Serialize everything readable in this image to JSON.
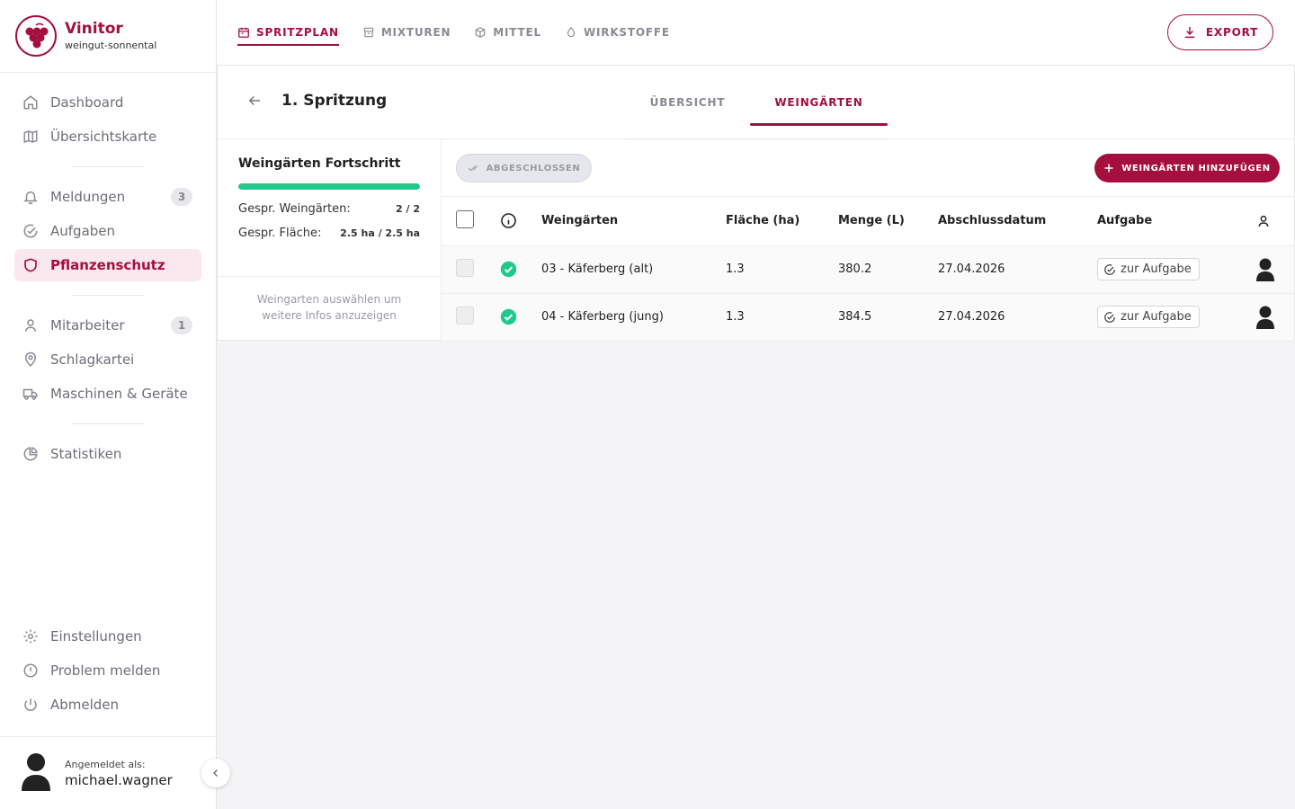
{
  "brand": {
    "name": "Vinitor",
    "subtitle": "weingut-sonnental",
    "accent": "#a50f3d"
  },
  "sidebar": {
    "group1": [
      {
        "label": "Dashboard",
        "icon": "home-icon"
      },
      {
        "label": "Übersichtskarte",
        "icon": "map-icon"
      }
    ],
    "group2": [
      {
        "label": "Meldungen",
        "icon": "bell-icon",
        "badge": "3"
      },
      {
        "label": "Aufgaben",
        "icon": "check-circle-icon"
      },
      {
        "label": "Pflanzenschutz",
        "icon": "shield-icon",
        "active": true
      }
    ],
    "group3": [
      {
        "label": "Mitarbeiter",
        "icon": "user-icon",
        "badge": "1"
      },
      {
        "label": "Schlagkartei",
        "icon": "map-pin-icon"
      },
      {
        "label": "Maschinen & Geräte",
        "icon": "truck-icon"
      }
    ],
    "group4": [
      {
        "label": "Statistiken",
        "icon": "pie-chart-icon"
      }
    ],
    "bottom": [
      {
        "label": "Einstellungen",
        "icon": "gear-icon"
      },
      {
        "label": "Problem melden",
        "icon": "alert-circle-icon"
      },
      {
        "label": "Abmelden",
        "icon": "power-icon"
      }
    ]
  },
  "user": {
    "label": "Angemeldet als:",
    "name": "michael.wagner"
  },
  "topnav": {
    "tabs": [
      {
        "label": "SPRITZPLAN",
        "icon": "calendar-icon",
        "active": true
      },
      {
        "label": "MIXTUREN",
        "icon": "archive-icon"
      },
      {
        "label": "MITTEL",
        "icon": "box-icon"
      },
      {
        "label": "WIRKSTOFFE",
        "icon": "droplet-icon"
      }
    ],
    "export_label": "EXPORT"
  },
  "detail": {
    "title": "1. Spritzung",
    "tabs": [
      {
        "label": "ÜBERSICHT"
      },
      {
        "label": "WEINGÄRTEN",
        "active": true
      }
    ]
  },
  "progress": {
    "title": "Weingärten Fortschritt",
    "fraction": 1.0,
    "fill_color": "#22c98a",
    "stats": [
      {
        "label": "Gespr. Weingärten:",
        "value": "2 / 2"
      },
      {
        "label": "Gespr. Fläche:",
        "value": "2.5 ha / 2.5 ha"
      }
    ],
    "hint": "Weingarten auswählen um weitere Infos anzuzeigen"
  },
  "toolbar": {
    "done_label": "ABGESCHLOSSEN",
    "add_label": "WEINGÄRTEN HINZUFÜGEN"
  },
  "table": {
    "columns": [
      "Weingärten",
      "Fläche (ha)",
      "Menge (L)",
      "Abschlussdatum",
      "Aufgabe"
    ],
    "rows": [
      {
        "name": "03 - Käferberg (alt)",
        "area": "1.3",
        "amount": "380.2",
        "date": "27.04.2026",
        "task": "zur Aufgabe",
        "status": "done"
      },
      {
        "name": "04 - Käferberg (jung)",
        "area": "1.3",
        "amount": "384.5",
        "date": "27.04.2026",
        "task": "zur Aufgabe",
        "status": "done"
      }
    ]
  }
}
